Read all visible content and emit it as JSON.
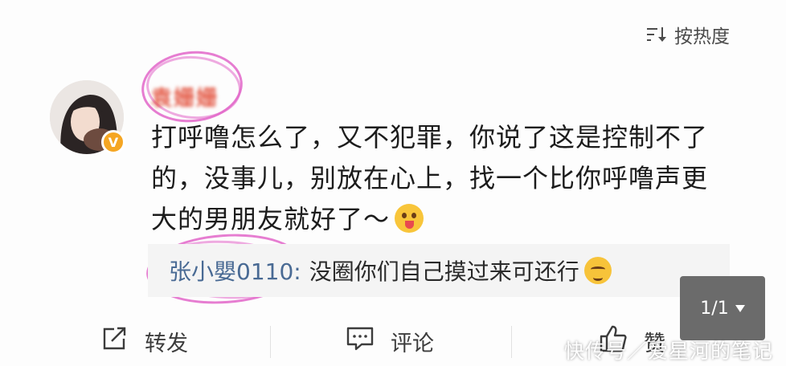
{
  "sort": {
    "label": "按热度",
    "icon": "sort-icon"
  },
  "comment": {
    "username": "袁姗姗",
    "verified_badge": "V",
    "text": "打呼噜怎么了，又不犯罪，你说了这是控制不了的，没事儿，别放在心上，找一个比你呼噜声更大的男朋友就好了～",
    "emoji": "tongue-out-emoji"
  },
  "reply": {
    "name": "张小嬰0110",
    "separator": ":",
    "text": "没圈你们自己摸过来可还行",
    "emoji": "upside-down-smile-emoji"
  },
  "pager": {
    "label": "1/1"
  },
  "actions": {
    "forward_label": "转发",
    "comment_label": "评论",
    "like_label": "赞"
  },
  "watermark": "快传号／爱星河的笔记"
}
